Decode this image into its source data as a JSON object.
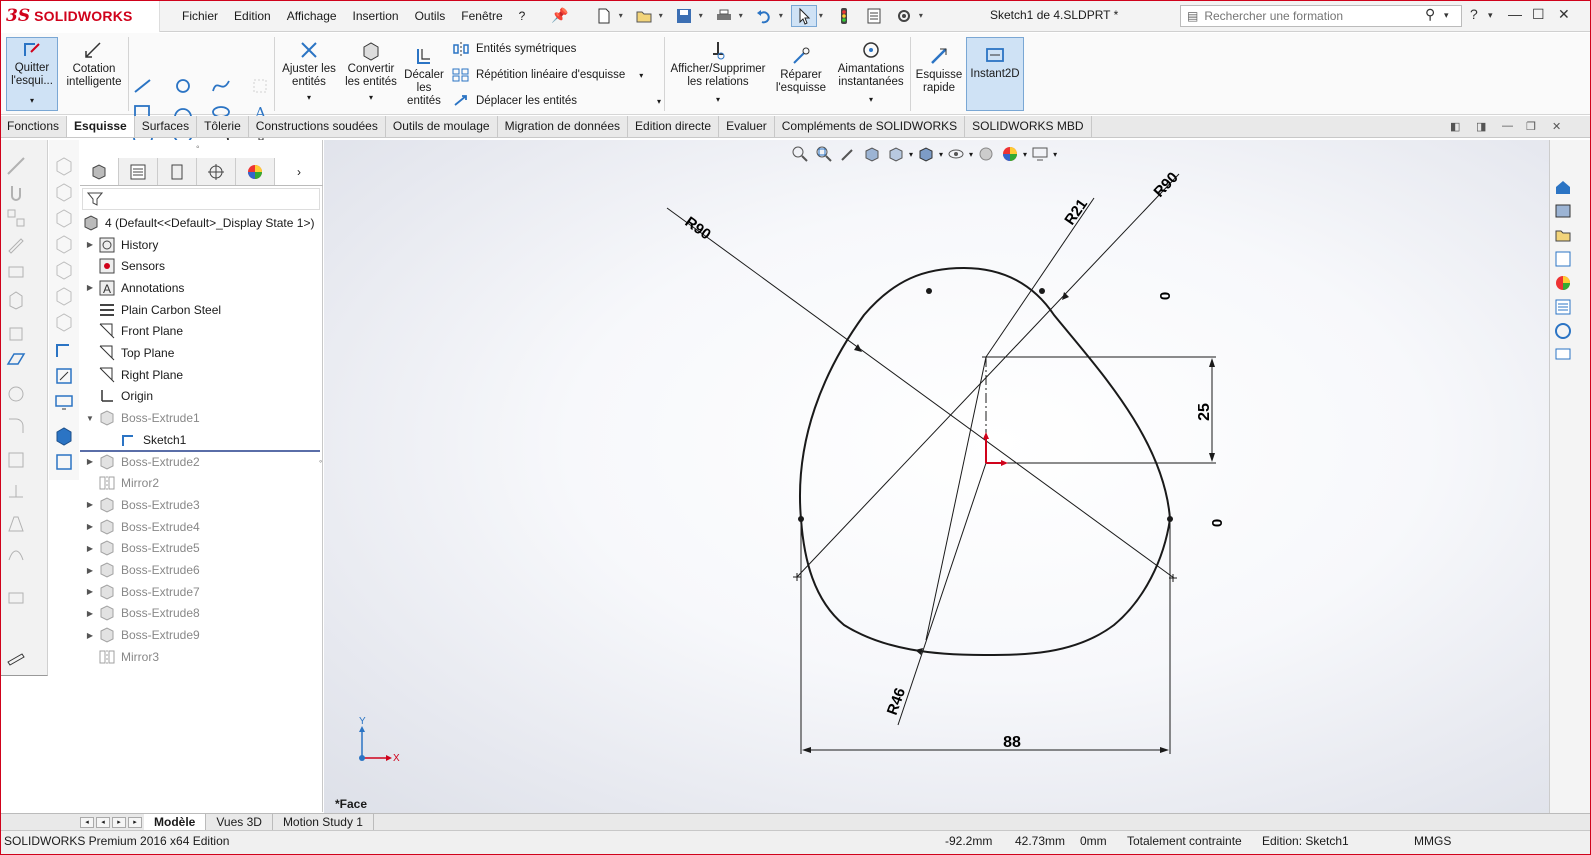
{
  "app": {
    "brand": "SOLIDWORKS",
    "doc_title": "Sketch1 de 4.SLDPRT *"
  },
  "menu": [
    "Fichier",
    "Edition",
    "Affichage",
    "Insertion",
    "Outils",
    "Fenêtre",
    "?"
  ],
  "search": {
    "placeholder": "Rechercher une formation"
  },
  "commands": {
    "exit_sketch": "Quitter l'esqui...",
    "smart_dim": "Cotation intelligente",
    "trim": "Ajuster les entités",
    "convert": "Convertir les entités",
    "offset": "Décaler les entités",
    "mirror": "Entités symétriques",
    "linear_pattern": "Répétition linéaire d'esquisse",
    "move": "Déplacer les entités",
    "relations": "Afficher/Supprimer les relations",
    "repair": "Réparer l'esquisse",
    "snaps": "Aimantations instantanées",
    "quick_sketch": "Esquisse rapide",
    "instant2d": "Instant2D"
  },
  "tabs": [
    "Fonctions",
    "Esquisse",
    "Surfaces",
    "Tôlerie",
    "Constructions soudées",
    "Outils de moulage",
    "Migration de données",
    "Edition directe",
    "Evaluer",
    "Compléments de SOLIDWORKS",
    "SOLIDWORKS MBD"
  ],
  "tree": {
    "root": "4  (Default<<Default>_Display State 1>)",
    "items": [
      {
        "label": "History",
        "arrow": "▶",
        "dim": false,
        "indent": 0
      },
      {
        "label": "Sensors",
        "arrow": "",
        "dim": false,
        "indent": 0
      },
      {
        "label": "Annotations",
        "arrow": "▶",
        "dim": false,
        "indent": 0
      },
      {
        "label": "Plain Carbon Steel",
        "arrow": "",
        "dim": false,
        "indent": 0
      },
      {
        "label": "Front Plane",
        "arrow": "",
        "dim": false,
        "indent": 0
      },
      {
        "label": "Top Plane",
        "arrow": "",
        "dim": false,
        "indent": 0
      },
      {
        "label": "Right Plane",
        "arrow": "",
        "dim": false,
        "indent": 0
      },
      {
        "label": "Origin",
        "arrow": "",
        "dim": false,
        "indent": 0
      },
      {
        "label": "Boss-Extrude1",
        "arrow": "▼",
        "dim": true,
        "indent": 0
      },
      {
        "label": "Sketch1",
        "arrow": "",
        "dim": false,
        "indent": 1
      },
      {
        "label": "Boss-Extrude2",
        "arrow": "▶",
        "dim": true,
        "indent": 0
      },
      {
        "label": "Mirror2",
        "arrow": "",
        "dim": true,
        "indent": 0
      },
      {
        "label": "Boss-Extrude3",
        "arrow": "▶",
        "dim": true,
        "indent": 0
      },
      {
        "label": "Boss-Extrude4",
        "arrow": "▶",
        "dim": true,
        "indent": 0
      },
      {
        "label": "Boss-Extrude5",
        "arrow": "▶",
        "dim": true,
        "indent": 0
      },
      {
        "label": "Boss-Extrude6",
        "arrow": "▶",
        "dim": true,
        "indent": 0
      },
      {
        "label": "Boss-Extrude7",
        "arrow": "▶",
        "dim": true,
        "indent": 0
      },
      {
        "label": "Boss-Extrude8",
        "arrow": "▶",
        "dim": true,
        "indent": 0
      },
      {
        "label": "Boss-Extrude9",
        "arrow": "▶",
        "dim": true,
        "indent": 0
      },
      {
        "label": "Mirror3",
        "arrow": "",
        "dim": true,
        "indent": 0
      }
    ]
  },
  "sketch": {
    "dims": {
      "r90_left": "R90",
      "r21": "R21",
      "r90_right": "R90",
      "r46": "R46",
      "d25": "25",
      "d88": "88",
      "z1": "0",
      "z2": "0"
    },
    "axis_x": "X",
    "axis_y": "Y",
    "face_label": "*Face"
  },
  "bottom_tabs": [
    "Modèle",
    "Vues 3D",
    "Motion Study 1"
  ],
  "status": {
    "edition": "SOLIDWORKS Premium 2016 x64 Edition",
    "x": "-92.2mm",
    "y": "42.73mm",
    "z": "0mm",
    "state": "Totalement contrainte",
    "editing": "Edition: Sketch1",
    "units": "MMGS"
  },
  "colors": {
    "brand": "#d0021b",
    "accent": "#2b74c4",
    "origin": "#d0021b"
  }
}
